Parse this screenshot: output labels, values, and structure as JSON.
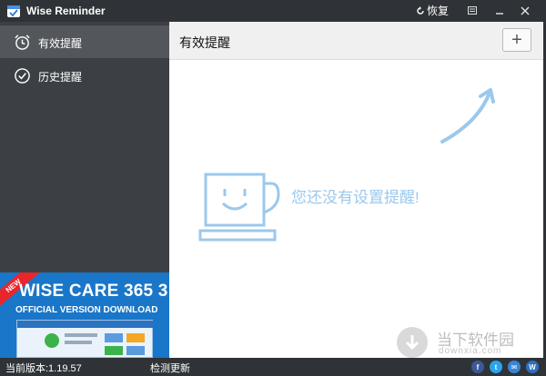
{
  "window": {
    "title": "Wise Reminder",
    "restore_label": "恢复"
  },
  "sidebar": {
    "items": [
      {
        "label": "有效提醒",
        "icon": "alarm-clock-icon",
        "active": true
      },
      {
        "label": "历史提醒",
        "icon": "check-circle-icon",
        "active": false
      }
    ]
  },
  "ad": {
    "ribbon": "NEW",
    "title": "WISE CARE 365 3",
    "subtitle": "OFFICIAL VERSION DOWNLOAD"
  },
  "main": {
    "title": "有效提醒",
    "add_label": "+",
    "empty_message": "您还没有设置提醒!"
  },
  "status": {
    "version": "当前版本:1.19.57",
    "check_update": "检测更新",
    "social": [
      "f",
      "t",
      "✉",
      "W"
    ]
  },
  "watermark": {
    "text": "当下软件园",
    "sub": "downxia.com"
  },
  "colors": {
    "titlebar": "#2f3337",
    "sidebar": "#3c4045",
    "sidebar_active": "#53575c",
    "accent_light_blue": "#9cc8ec",
    "ad_blue": "#1976c8"
  }
}
